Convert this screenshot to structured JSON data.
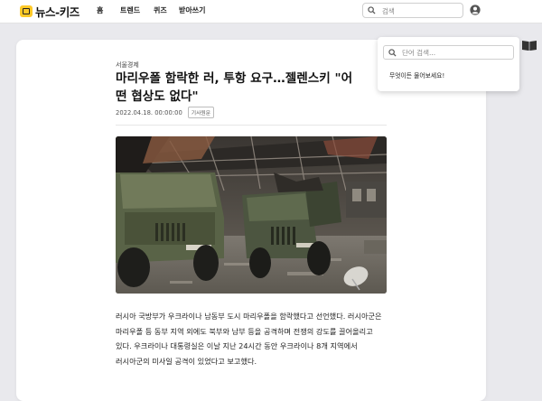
{
  "header": {
    "logo_text": "뉴스-키즈",
    "nav": [
      "홈",
      "트렌드",
      "퀴즈",
      "받아쓰기"
    ],
    "search_placeholder": "검색"
  },
  "article": {
    "category": "서울경제",
    "title_line1": "마리우폴 함락한 러, 투항 요구…젤렌스키 \"어",
    "title_line2": "떤 협상도 없다\"",
    "date": "2022.04.18. 00:00:00",
    "tag": "기사원문",
    "body": "러시아 국방부가 우크라이나 남동부 도시 마리우폴을 함락했다고 선언했다. 러시아군은 마리우폴 등 동부 지역 외에도 북부와 남부 등을 공격하며 전쟁의 강도를 끌어올리고 있다. 우크라이나 대통령실은 이날 지난 24시간 동안 우크라이나 8개 지역에서 러시아군의 미사일 공격이 있었다고 보고했다."
  },
  "ask_panel": {
    "placeholder": "단어 검색...",
    "message": "무엇이든 물어보세요!"
  },
  "colors": {
    "background": "#e9e9ed",
    "logo_accent": "#ffc928"
  }
}
